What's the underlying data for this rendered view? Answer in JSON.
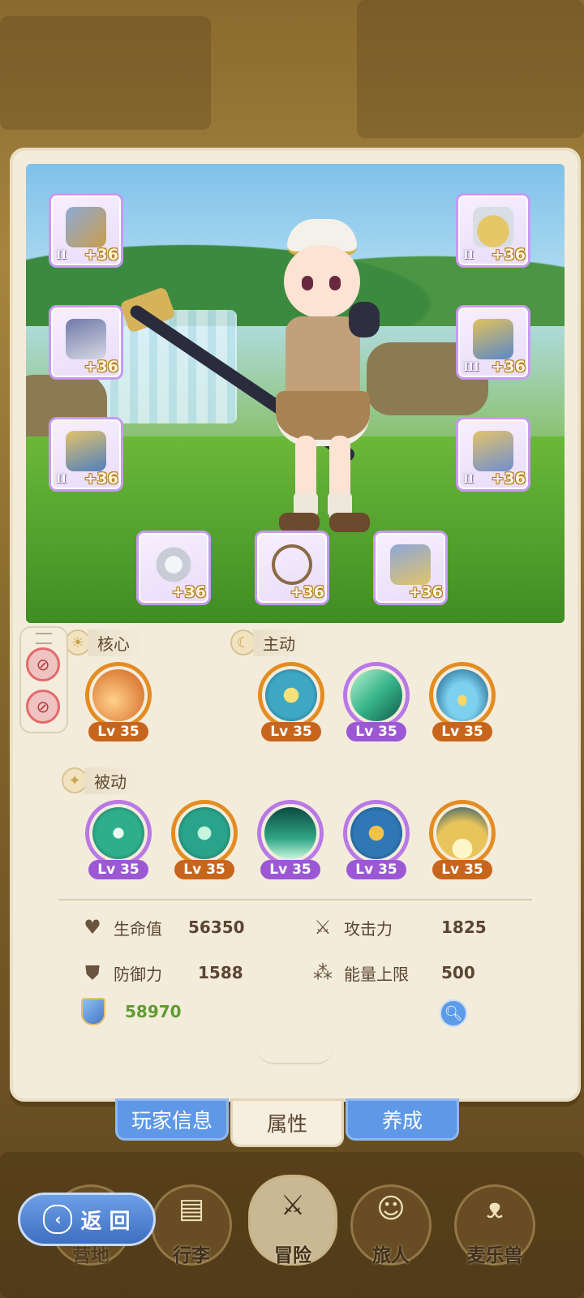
{
  "equipment": [
    {
      "name": "staff",
      "plus": "+36",
      "tier": "II",
      "color": "#8fa9d6"
    },
    {
      "name": "helmet",
      "plus": "+36",
      "tier": "II",
      "color": "#e6c766"
    },
    {
      "name": "armor",
      "plus": "+36",
      "tier": "",
      "color": "#6f79a8"
    },
    {
      "name": "gauntlet",
      "plus": "+36",
      "tier": "III",
      "color": "#5a89c9"
    },
    {
      "name": "belt",
      "plus": "+36",
      "tier": "II",
      "color": "#4f7fbf"
    },
    {
      "name": "boots",
      "plus": "+36",
      "tier": "II",
      "color": "#6f8fd2"
    },
    {
      "name": "ring",
      "plus": "+36",
      "tier": "",
      "color": "#c7ccd6"
    },
    {
      "name": "necklace",
      "plus": "+36",
      "tier": "",
      "color": "#b98b58"
    },
    {
      "name": "amulet",
      "plus": "+36",
      "tier": "",
      "color": "#8fa7d8"
    }
  ],
  "skills": {
    "core_label": "核心",
    "active_label": "主动",
    "passive_label": "被动",
    "core": [
      {
        "lv": "Lv 35",
        "rarity": "orange",
        "color": "#f0a24a"
      }
    ],
    "active": [
      {
        "lv": "Lv 35",
        "rarity": "orange",
        "color": "#3ea7c4"
      },
      {
        "lv": "Lv 35",
        "rarity": "purple",
        "color": "#39b58a"
      },
      {
        "lv": "Lv 35",
        "rarity": "orange",
        "color": "#2c8fc0"
      }
    ],
    "passive": [
      {
        "lv": "Lv 35",
        "rarity": "purple",
        "color": "#2fae8c"
      },
      {
        "lv": "Lv 35",
        "rarity": "orange",
        "color": "#29a48a"
      },
      {
        "lv": "Lv 35",
        "rarity": "purple",
        "color": "#2fa583"
      },
      {
        "lv": "Lv 35",
        "rarity": "purple",
        "color": "#2f78b5"
      },
      {
        "lv": "Lv 35",
        "rarity": "orange",
        "color": "#e8c45a"
      }
    ]
  },
  "stats": {
    "hp_label": "生命值",
    "hp": "56350",
    "atk_label": "攻击力",
    "atk": "1825",
    "def_label": "防御力",
    "def": "1588",
    "energy_label": "能量上限",
    "energy": "500",
    "power": "58970"
  },
  "tabs": {
    "player_info": "玩家信息",
    "attributes": "属性",
    "cultivate": "养成"
  },
  "nav": {
    "back": "返 回",
    "camp": "营地",
    "bag": "行李",
    "adventure": "冒险",
    "traveler": "旅人",
    "pet": "麦乐兽"
  }
}
